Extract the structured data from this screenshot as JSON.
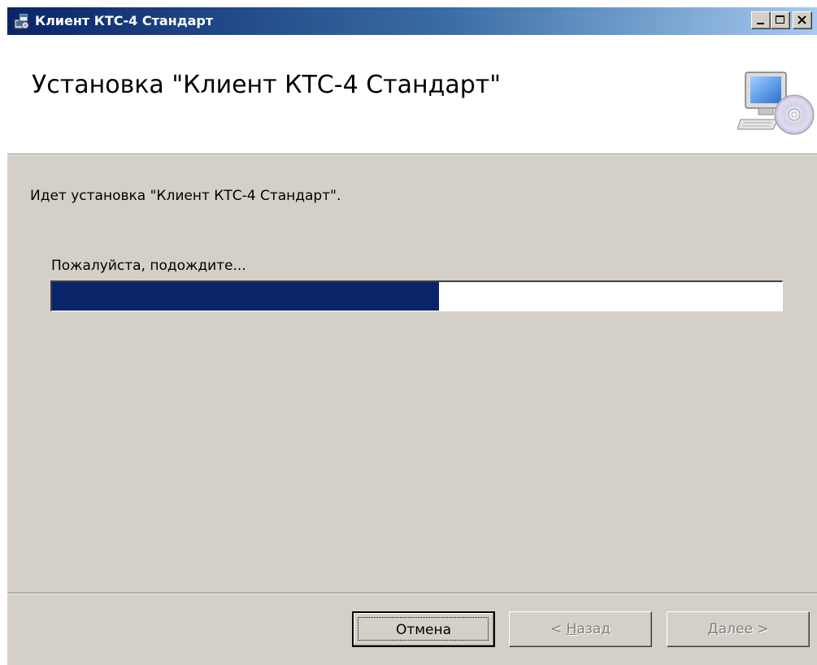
{
  "window": {
    "title": "Клиент КТС-4 Стандарт"
  },
  "header": {
    "title": "Установка \"Клиент КТС-4 Стандарт\"",
    "image_icon": "computer-with-cd-icon"
  },
  "content": {
    "status_text": "Идет установка \"Клиент КТС-4 Стандарт\".",
    "wait_text": "Пожалуйста, подождите...",
    "progress_fraction": 0.53
  },
  "buttons": {
    "cancel_label": "Отмена",
    "back_prefix": "< ",
    "back_mnemonic": "Н",
    "back_rest": "азад",
    "next_mnemonic": "Д",
    "next_rest": "алее",
    "next_suffix": " >"
  },
  "colors": {
    "titlebar_start": "#0a246a",
    "titlebar_end": "#a6caf0",
    "progress_fill": "#0a246a",
    "dialog_background": "#d4d0c8"
  }
}
